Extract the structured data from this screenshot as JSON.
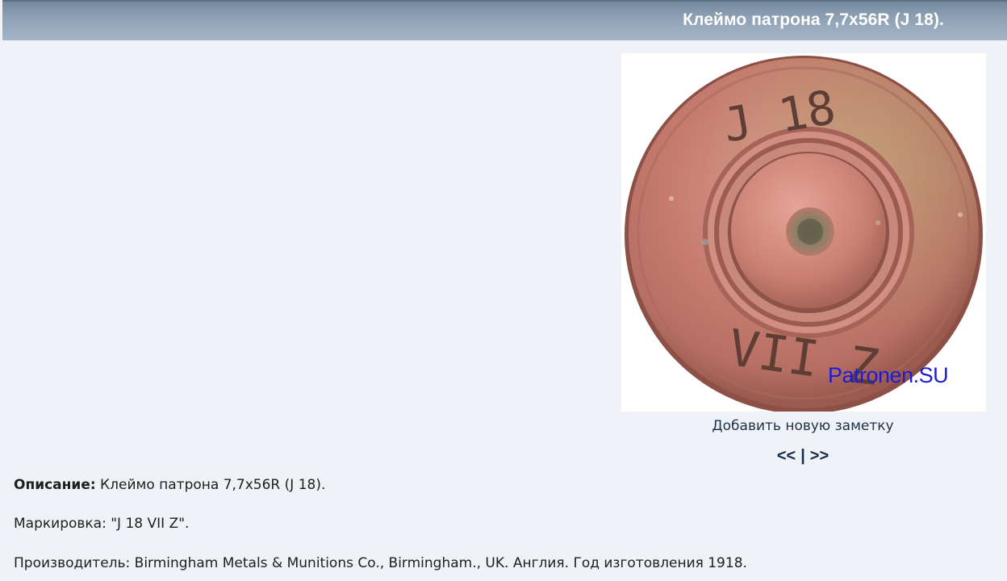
{
  "header": {
    "title": "Клеймо патрона 7,7х56R (J 18)."
  },
  "photo": {
    "headstamp_top": "J 18",
    "headstamp_bottom": "VII Z",
    "watermark": "Patronen.SU"
  },
  "actions": {
    "add_note": "Добавить новую заметку",
    "prev": "<<",
    "separator": "|",
    "next": ">>"
  },
  "description": {
    "label": "Описание:",
    "text": " Клеймо патрона 7,7х56R (J 18).",
    "marking": "Маркировка: \"J 18 VII Z\".",
    "manufacturer": "Производитель: Birmingham Metals & Munitions Co., Birmingham., UK. Англия. Год изготовления 1918."
  }
}
